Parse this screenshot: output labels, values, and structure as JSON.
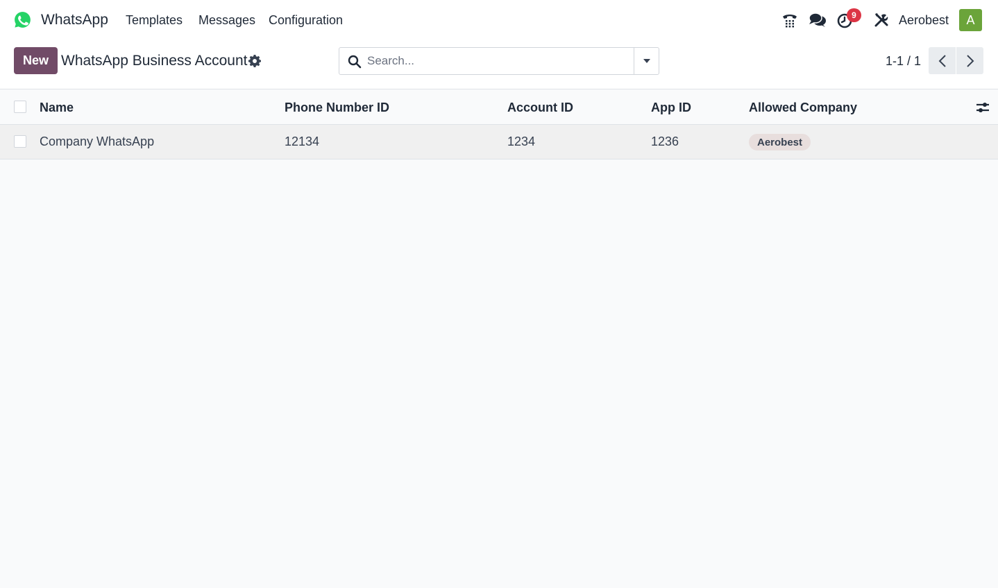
{
  "navbar": {
    "app_name": "WhatsApp",
    "menu": [
      "Templates",
      "Messages",
      "Configuration"
    ],
    "activity_count": "9",
    "company": "Aerobest",
    "avatar_letter": "A",
    "icons": [
      "phone-icon",
      "chat-icon",
      "clock-icon",
      "tools-icon"
    ]
  },
  "control_panel": {
    "new_label": "New",
    "title": "WhatsApp Business Account",
    "search_placeholder": "Search...",
    "pager": "1-1 / 1"
  },
  "table": {
    "columns": [
      "Name",
      "Phone Number ID",
      "Account ID",
      "App ID",
      "Allowed Company"
    ],
    "rows": [
      {
        "name": "Company WhatsApp",
        "phone_number_id": "12134",
        "account_id": "1234",
        "app_id": "1236",
        "allowed_company": "Aerobest"
      }
    ]
  },
  "colors": {
    "brand": "#714b67",
    "whatsapp_green": "#25d366",
    "badge": "#dc3545",
    "avatar": "#6ba43a",
    "tag_bg": "#e8dedd"
  }
}
